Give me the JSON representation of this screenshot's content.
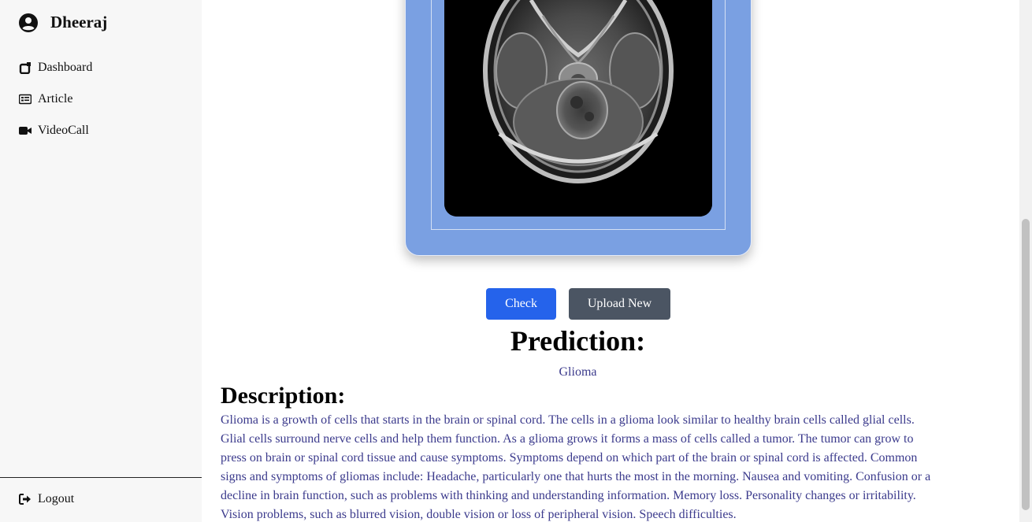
{
  "user": {
    "name": "Dheeraj",
    "icon": "user-circle-icon"
  },
  "sidebar": {
    "items": [
      {
        "label": "Dashboard",
        "icon": "dashboard-icon"
      },
      {
        "label": "Article",
        "icon": "article-icon"
      },
      {
        "label": "VideoCall",
        "icon": "video-icon"
      }
    ],
    "logout": {
      "label": "Logout",
      "icon": "logout-icon"
    }
  },
  "upload": {
    "image_alt": "Brain MRI scan"
  },
  "actions": {
    "check_label": "Check",
    "upload_new_label": "Upload New"
  },
  "prediction": {
    "heading": "Prediction:",
    "value": "Glioma"
  },
  "description": {
    "heading": "Description:",
    "text": "Glioma is a growth of cells that starts in the brain or spinal cord. The cells in a glioma look similar to healthy brain cells called glial cells. Glial cells surround nerve cells and help them function. As a glioma grows it forms a mass of cells called a tumor. The tumor can grow to press on brain or spinal cord tissue and cause symptoms. Symptoms depend on which part of the brain or spinal cord is affected. Common signs and symptoms of gliomas include: Headache, particularly one that hurts the most in the morning. Nausea and vomiting. Confusion or a decline in brain function, such as problems with thinking and understanding information. Memory loss. Personality changes or irritability. Vision problems, such as blurred vision, double vision or loss of peripheral vision. Speech difficulties."
  },
  "colors": {
    "accent": "#2563eb",
    "secondary_button": "#4b5563",
    "card": "#7aa0e2",
    "text_body": "#3b3a8c"
  }
}
